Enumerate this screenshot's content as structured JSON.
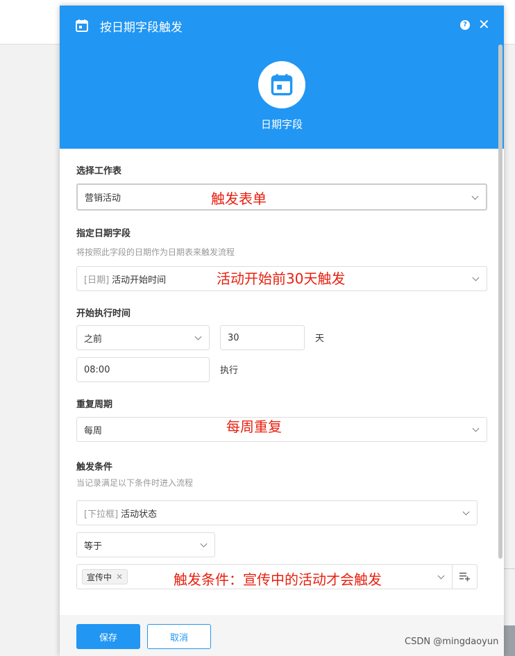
{
  "dialog": {
    "title": "按日期字段触发",
    "hero_label": "日期字段"
  },
  "worksheet": {
    "label": "选择工作表",
    "value": "营销活动",
    "annotation": "触发表单"
  },
  "date_field": {
    "label": "指定日期字段",
    "hint": "将按照此字段的日期作为日期表来触发流程",
    "prefix": "[日期]",
    "value": "活动开始时间",
    "annotation": "活动开始前30天触发"
  },
  "start_time": {
    "label": "开始执行时间",
    "direction": "之前",
    "offset": "30",
    "unit": "天",
    "time": "08:00",
    "exec_label": "执行"
  },
  "repeat": {
    "label": "重复周期",
    "value": "每周",
    "annotation": "每周重复"
  },
  "condition": {
    "label": "触发条件",
    "hint": "当记录满足以下条件时进入流程",
    "field_prefix": "[下拉框]",
    "field_value": "活动状态",
    "operator": "等于",
    "tag": "宣传中",
    "annotation": "触发条件：宣传中的活动才会触发"
  },
  "footer": {
    "save": "保存",
    "cancel": "取消"
  },
  "watermark": "CSDN @mingdaoyun",
  "colors": {
    "primary": "#2196f3",
    "annotation": "#e8200f"
  }
}
